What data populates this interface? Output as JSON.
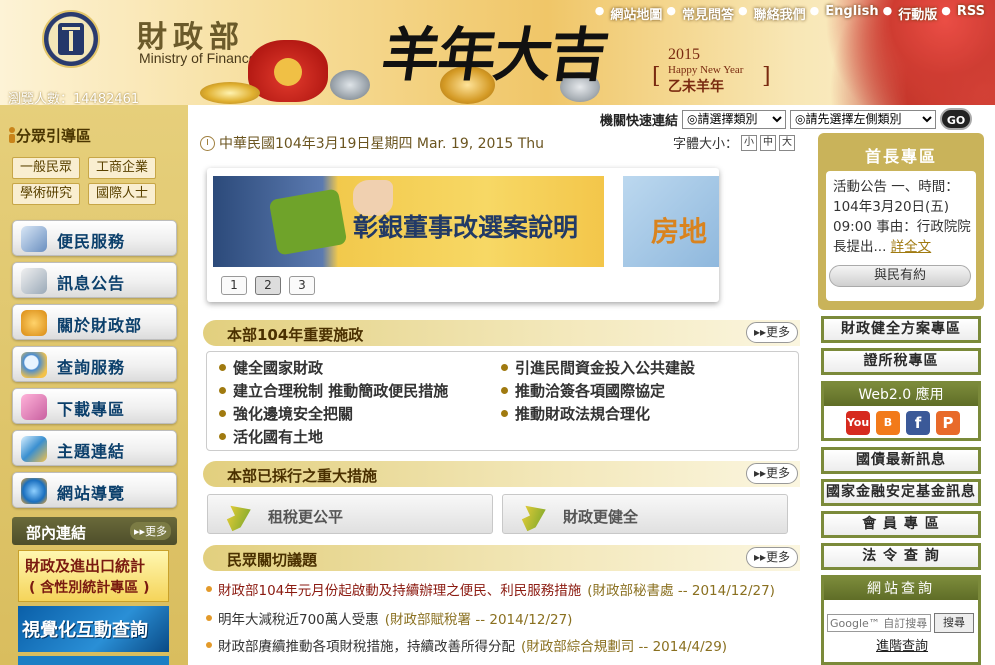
{
  "header": {
    "title_zh": "財政部",
    "title_en": "Ministry of Finance, R.O.C.",
    "visitors": "瀏覽人數：14482461",
    "callig": "羊年大吉",
    "ny_year": "2015",
    "ny_en": "Happy New Year",
    "ny_zh": "乙未羊年",
    "topnav": [
      "網站地圖",
      "常見問答",
      "聯絡我們",
      "English",
      "行動版",
      "RSS"
    ]
  },
  "quick": {
    "label": "機關快速連結",
    "select1": "◎請選擇類別",
    "select2": "◎請先選擇左側類別",
    "go": "GO"
  },
  "left": {
    "guide_title": "分眾引導區",
    "guide": [
      "一般民眾",
      "工商企業",
      "學術研究",
      "國際人士"
    ],
    "menu": [
      "便民服務",
      "訊息公告",
      "關於財政部",
      "查詢服務",
      "下載專區",
      "主題連結",
      "網站導覽"
    ],
    "inside_title": "部內連結",
    "inside_more": "更多",
    "promo1_l1": "財政及進出口統計",
    "promo1_l2": "( 含性別統計專區 )",
    "promo2": "視覺化互動查詢"
  },
  "main": {
    "date": "中華民國104年3月19日星期四 Mar. 19, 2015 Thu",
    "font_label": "字體大小：",
    "font_sizes": [
      "小",
      "中",
      "大"
    ],
    "slide1": "彰銀董事改選案說明",
    "slide2": "房地",
    "pager": [
      "1",
      "2",
      "3"
    ],
    "sec1_title": "本部104年重要施政",
    "more": "更多",
    "policies": [
      "健全國家財政",
      "建立合理稅制 推動簡政便民措施",
      "強化邊境安全把關",
      "活化國有土地",
      "引進民間資金投入公共建設",
      "推動洽簽各項國際協定",
      "推動財政法規合理化"
    ],
    "sec2_title": "本部已採行之重大措施",
    "measures": [
      "租稅更公平",
      "財政更健全"
    ],
    "sec3_title": "民眾關切議題",
    "news": [
      {
        "title": "財政部104年元月份起啟動及持續辦理之便民、利民服務措施",
        "src": "(財政部秘書處 -- 2014/12/27)"
      },
      {
        "title": "明年大減稅近700萬人受惠",
        "src": "(財政部賦稅署 -- 2014/12/27)"
      },
      {
        "title": "財政部賡續推動各項財稅措施，持續改善所得分配",
        "src": "(財政部綜合規劃司 -- 2014/4/29)"
      }
    ]
  },
  "right": {
    "chief_title": "首長專區",
    "chief_text": "活動公告 一、時間：104年3月20日(五) 09:00 事由：行政院院長提出...",
    "chief_link": "詳全文",
    "chief_btn": "與民有約",
    "buttons": [
      "財政健全方案專區",
      "證所稅專區"
    ],
    "web20_title": "Web2.0 應用",
    "social": [
      "You Tube",
      "blogger",
      "facebook",
      "plurk"
    ],
    "buttons2": [
      "國債最新訊息",
      "國家金融安定基金訊息",
      "會 員 專 區",
      "法 令 查 詢"
    ],
    "search_title": "網站查詢",
    "search_placeholder": "Google™ 自訂搜尋",
    "search_btn": "搜尋",
    "adv_search": "進階查詢"
  }
}
